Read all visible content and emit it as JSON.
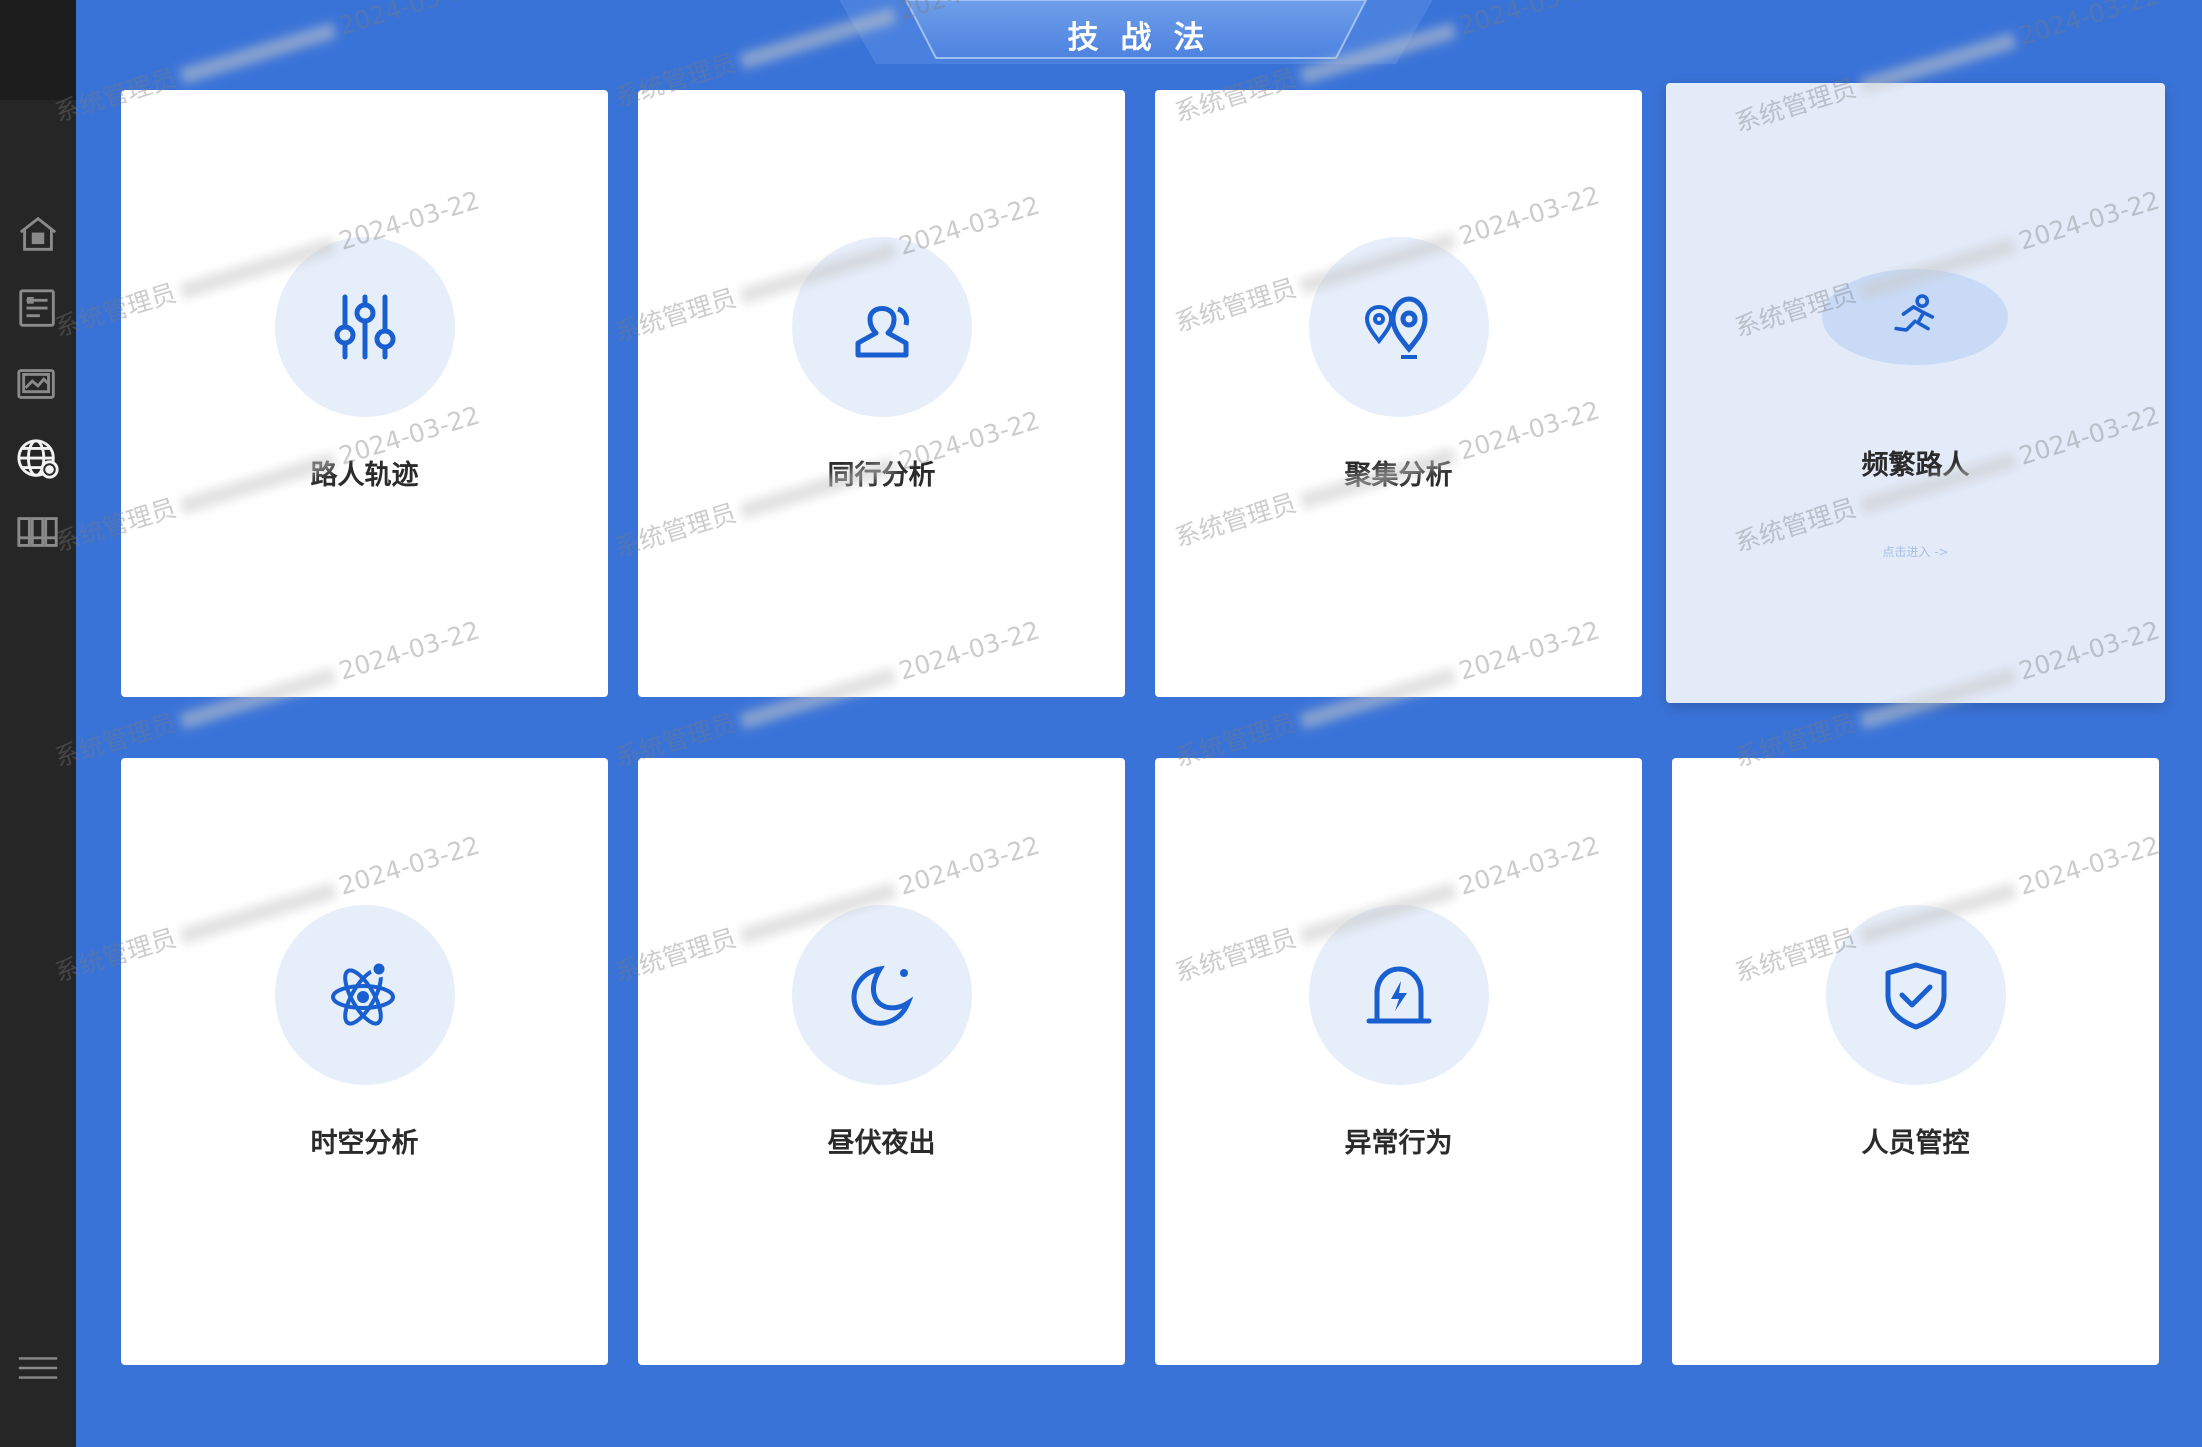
{
  "header": {
    "title": "技战法"
  },
  "sidebar": {
    "items": [
      {
        "icon": "home-icon",
        "active": false
      },
      {
        "icon": "list-icon",
        "active": false
      },
      {
        "icon": "image-frame-icon",
        "active": false
      },
      {
        "icon": "globe-eye-icon",
        "active": true
      },
      {
        "icon": "library-icon",
        "active": false
      }
    ],
    "bottom_icon": "menu-icon"
  },
  "cards": [
    {
      "label": "路人轨迹",
      "icon": "sliders-icon"
    },
    {
      "label": "同行分析",
      "icon": "person-icon"
    },
    {
      "label": "聚集分析",
      "icon": "map-pins-icon"
    },
    {
      "label": "频繁路人",
      "icon": "running-person-icon",
      "hint": "点击进入 ->"
    },
    {
      "label": "时空分析",
      "icon": "atom-icon"
    },
    {
      "label": "昼伏夜出",
      "icon": "moon-icon"
    },
    {
      "label": "异常行为",
      "icon": "alarm-light-icon"
    },
    {
      "label": "人员管控",
      "icon": "shield-check-icon"
    }
  ],
  "watermark": {
    "user": "系统管理员",
    "date": "2024-03-22"
  },
  "colors": {
    "background": "#3a73d8",
    "sidebar": "#262626",
    "accent": "#1a5fd0",
    "icon_circle": "#e6eefa"
  }
}
